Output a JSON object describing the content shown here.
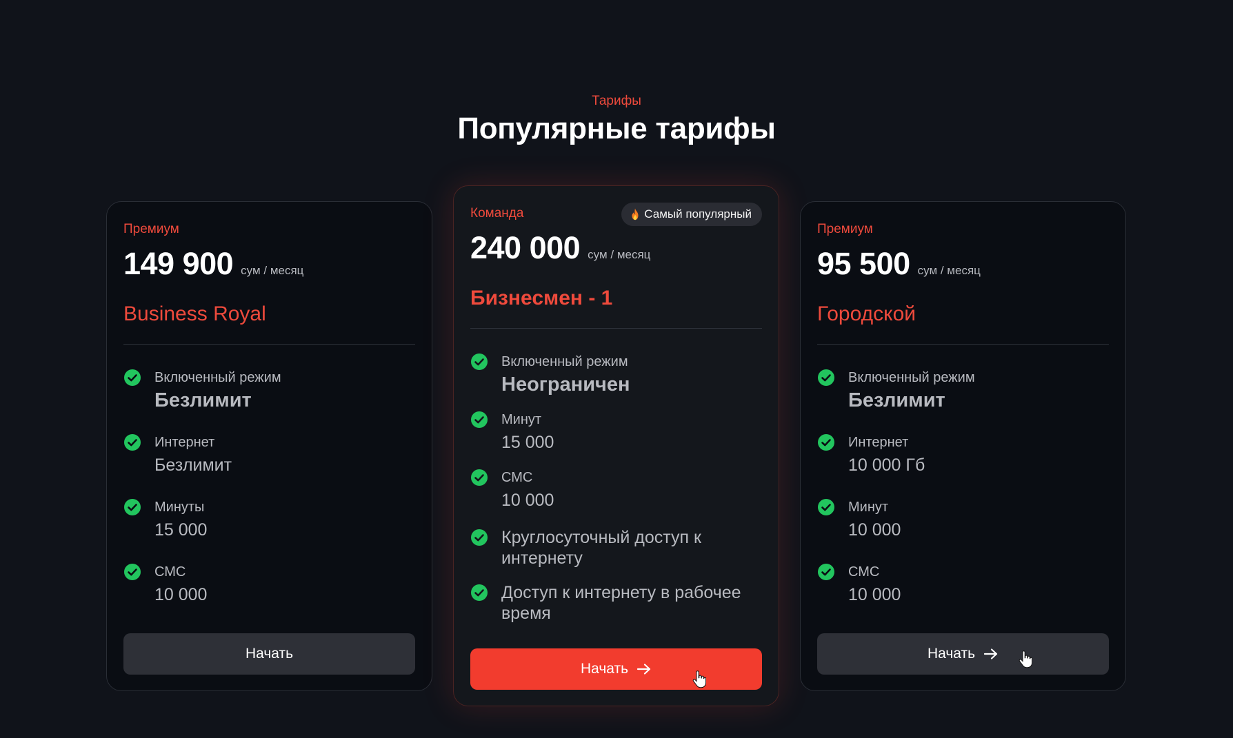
{
  "section": {
    "eyebrow": "Тарифы",
    "title": "Популярные тарифы"
  },
  "colors": {
    "accent": "#ee4a3c",
    "button_primary": "#f23c2e",
    "button_secondary": "#2e3037",
    "check": "#22c55e",
    "background": "#10131a"
  },
  "plans": [
    {
      "kind": "Премиум",
      "price": "149 900",
      "unit": "сум / месяц",
      "name": "Business Royal",
      "features": [
        {
          "label": "Включенный режим",
          "value": "Безлимит"
        },
        {
          "label": "Интернет",
          "value": "Безлимит"
        },
        {
          "label": "Минуты",
          "value": "15 000"
        },
        {
          "label": "СМС",
          "value": "10 000"
        }
      ],
      "button": "Начать",
      "button_icon": ""
    },
    {
      "kind": "Команда",
      "badge": "Самый популярный",
      "badge_icon": "fire-icon",
      "price": "240 000",
      "unit": "сум / месяц",
      "name": "Бизнесмен - 1",
      "features": [
        {
          "label": "Включенный режим",
          "value": "Неограничен"
        },
        {
          "label": "Минут",
          "value": "15 000"
        },
        {
          "label": "СМС",
          "value": "10 000"
        },
        {
          "text": "Круглосуточный доступ к интернету"
        },
        {
          "text": "Доступ к интернету в рабочее время"
        }
      ],
      "button": "Начать",
      "button_icon": "arrow-right-icon"
    },
    {
      "kind": "Премиум",
      "price": "95 500",
      "unit": "сум / месяц",
      "name": "Городской",
      "features": [
        {
          "label": "Включенный режим",
          "value": "Безлимит"
        },
        {
          "label": "Интернет",
          "value": "10 000 Гб"
        },
        {
          "label": "Минут",
          "value": "10 000"
        },
        {
          "label": "СМС",
          "value": "10 000"
        }
      ],
      "button": "Начать",
      "button_icon": "arrow-right-icon"
    }
  ]
}
